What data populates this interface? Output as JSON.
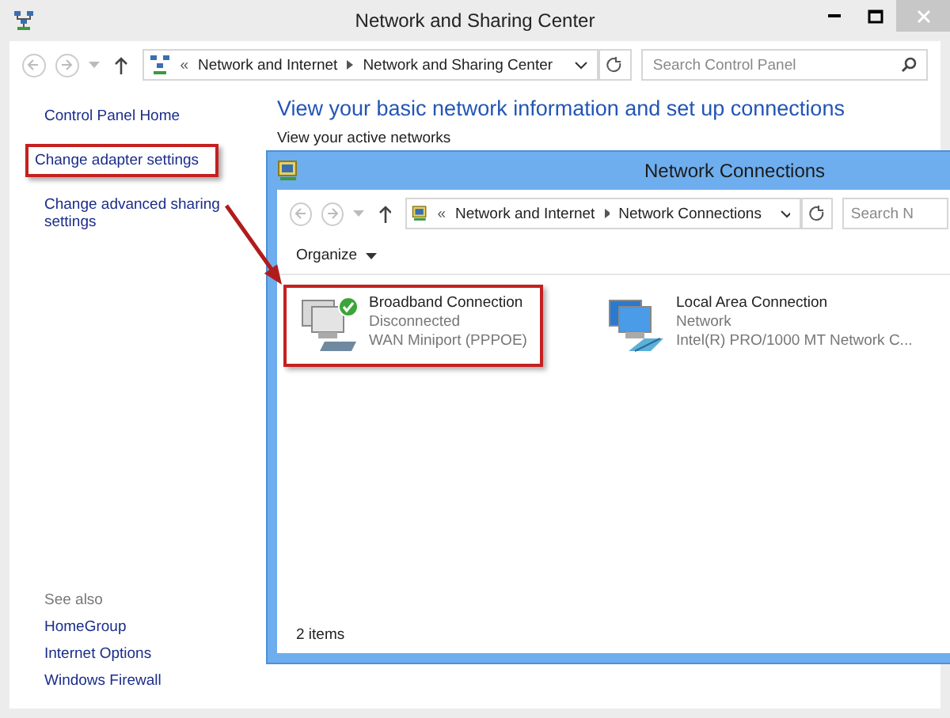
{
  "window": {
    "title": "Network and Sharing Center"
  },
  "address_bar": {
    "overflow": "«",
    "path": [
      "Network and Internet",
      "Network and Sharing Center"
    ],
    "search": {
      "placeholder": "Search Control Panel"
    }
  },
  "sidebar": {
    "items": [
      {
        "label": "Control Panel Home",
        "highlighted": false
      },
      {
        "label": "Change adapter settings",
        "highlighted": true
      },
      {
        "label": "Change advanced sharing settings",
        "highlighted": false
      }
    ],
    "see_also": {
      "heading": "See also",
      "items": [
        "HomeGroup",
        "Internet Options",
        "Windows Firewall"
      ]
    }
  },
  "main": {
    "heading": "View your basic network information and set up connections",
    "subheading": "View your active networks"
  },
  "dialog": {
    "title": "Network Connections",
    "address_bar": {
      "overflow": "«",
      "path": [
        "Network and Internet",
        "Network Connections"
      ],
      "search": {
        "placeholder": "Search N"
      }
    },
    "toolbar": {
      "organize": "Organize"
    },
    "connections": [
      {
        "name": "Broadband Connection",
        "status": "Disconnected",
        "device": "WAN Miniport (PPPOE)",
        "kind": "broadband",
        "highlighted": true
      },
      {
        "name": "Local Area Connection",
        "status": "Network",
        "device": "Intel(R) PRO/1000 MT Network C...",
        "kind": "lan",
        "highlighted": false
      }
    ],
    "status_bar": "2 items"
  }
}
